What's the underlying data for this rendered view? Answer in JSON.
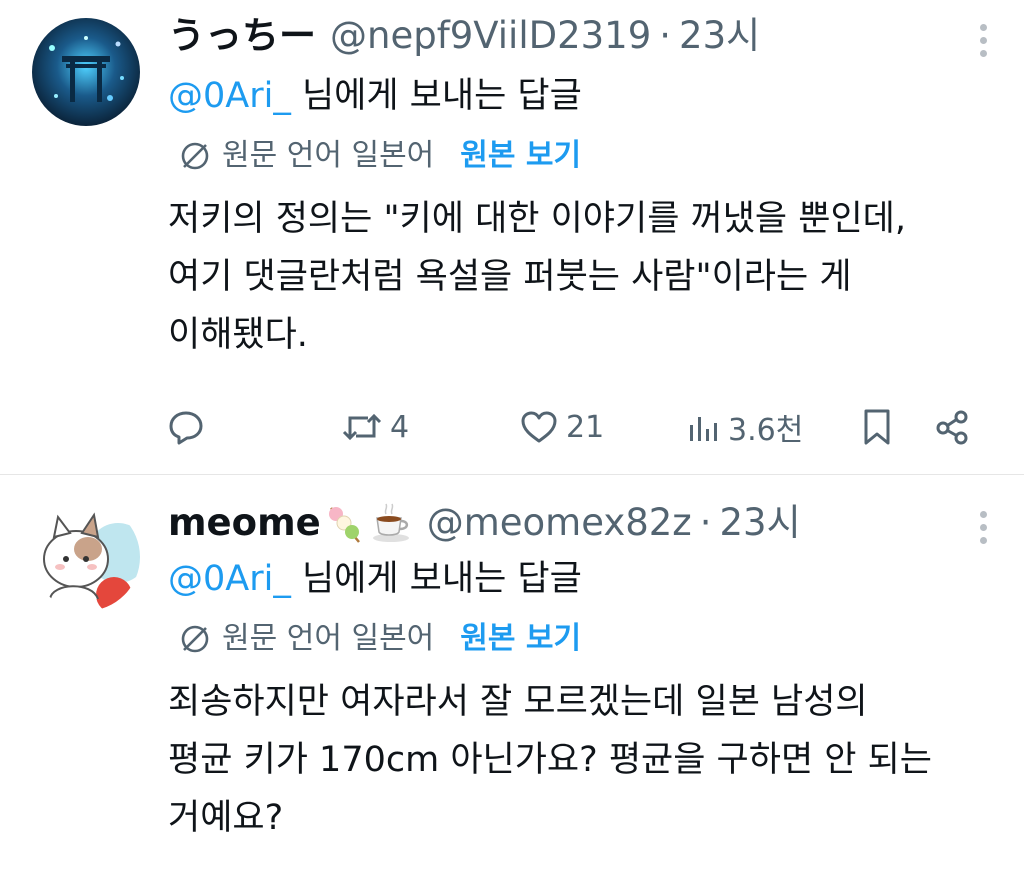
{
  "tweets": [
    {
      "name": "うっちー",
      "handle": "@nepf9ViilD2319",
      "sep": "·",
      "time": "23시",
      "reply_mention": "@0Ari_",
      "reply_suffix": " 님에게 보내는 답글",
      "source_lang": "원문 언어 일본어",
      "show_original": "원본 보기",
      "body_lines": [
        "저키의 정의는 \"키에 대한 이야기를 꺼냈을 뿐인데,",
        "여기 댓글란처럼 욕설을 퍼붓는 사람\"이라는 게",
        "이해됐다."
      ],
      "retweets": "4",
      "likes": "21",
      "views": "3.6천"
    },
    {
      "name": "meome",
      "name_emojis": [
        "dango-emoji",
        "teacup-emoji"
      ],
      "handle": "@meomex82z",
      "sep": "·",
      "time": "23시",
      "reply_mention": "@0Ari_",
      "reply_suffix": " 님에게 보내는 답글",
      "source_lang": "원문 언어 일본어",
      "show_original": "원본 보기",
      "body_lines": [
        "죄송하지만 여자라서 잘 모르겠는데 일본 남성의",
        "평균 키가 170cm 아닌가요? 평균을 구하면 안 되는",
        "거예요?"
      ]
    }
  ],
  "colors": {
    "accent": "#1d9bf0",
    "secondary_text": "#536471",
    "primary_text": "#0f1419"
  },
  "icons": [
    "reply-icon",
    "retweet-icon",
    "like-icon",
    "views-icon",
    "bookmark-icon",
    "share-icon",
    "globe-translate-icon",
    "more-vertical-icon"
  ]
}
